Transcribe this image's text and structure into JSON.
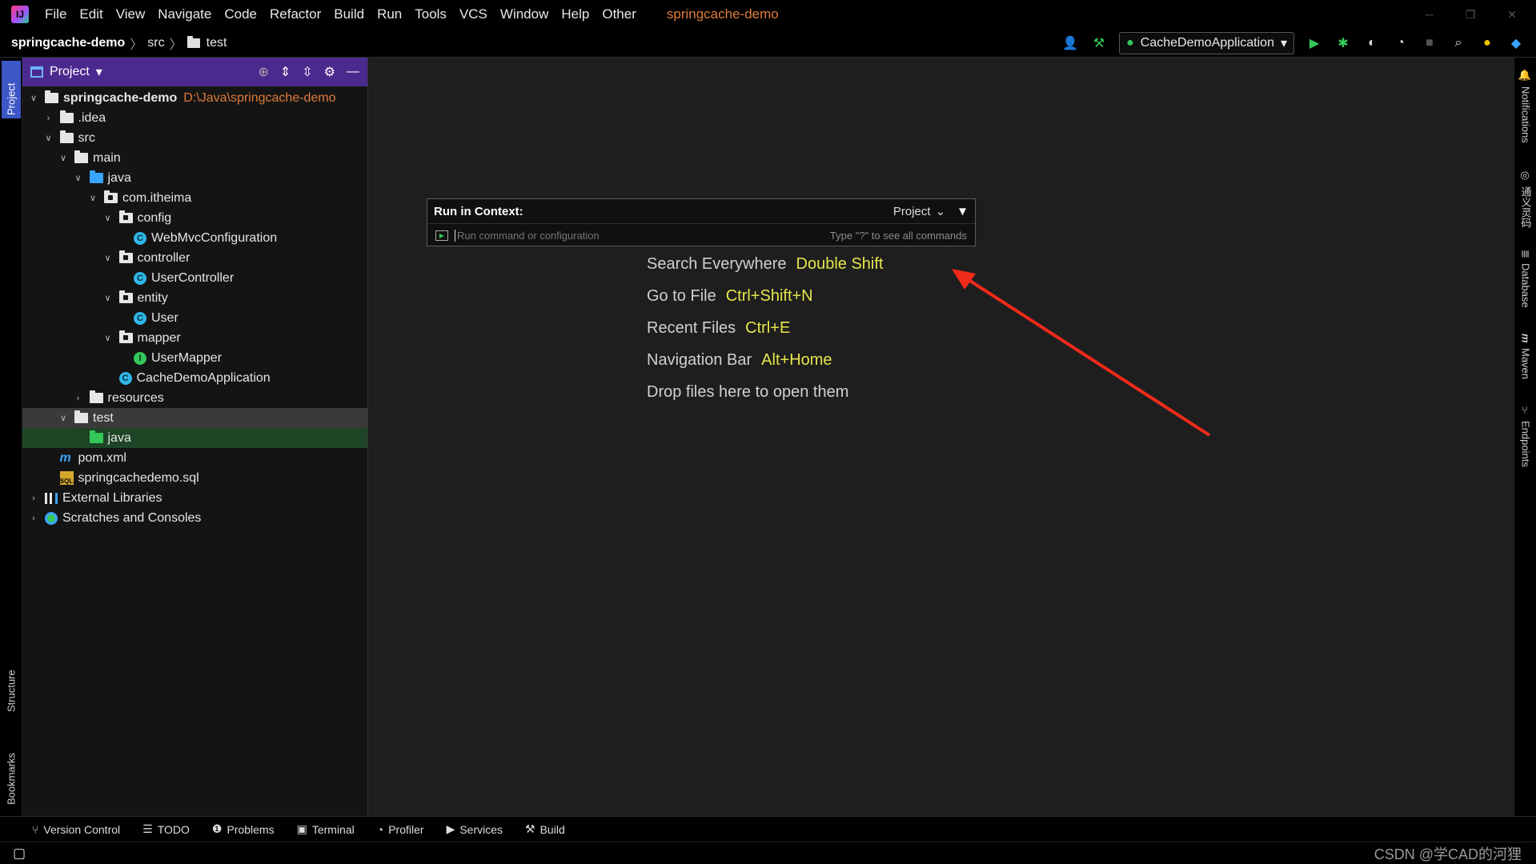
{
  "menubar": {
    "items": [
      "File",
      "Edit",
      "View",
      "Navigate",
      "Code",
      "Refactor",
      "Build",
      "Run",
      "Tools",
      "VCS",
      "Window",
      "Help",
      "Other"
    ],
    "project_title": "springcache-demo"
  },
  "navbar": {
    "breadcrumb": [
      "springcache-demo",
      "src",
      "test"
    ],
    "run_config": "CacheDemoApplication"
  },
  "left_strip": {
    "project_tab": "Project",
    "structure_tab": "Structure",
    "bookmarks_tab": "Bookmarks"
  },
  "right_strip": {
    "notifications": "Notifications",
    "translate": "通义灵码",
    "database": "Database",
    "maven": "Maven",
    "endpoints": "Endpoints"
  },
  "project_panel": {
    "title": "Project",
    "tree": [
      {
        "label": "springcache-demo",
        "path": "D:\\Java\\springcache-demo",
        "level": 0,
        "arrow": "open",
        "icon": "folder",
        "bold": true
      },
      {
        "label": ".idea",
        "level": 1,
        "arrow": "closed",
        "icon": "folder"
      },
      {
        "label": "src",
        "level": 1,
        "arrow": "open",
        "icon": "folder"
      },
      {
        "label": "main",
        "level": 2,
        "arrow": "open",
        "icon": "folder"
      },
      {
        "label": "java",
        "level": 3,
        "arrow": "open",
        "icon": "folder-blue"
      },
      {
        "label": "com.itheima",
        "level": 4,
        "arrow": "open",
        "icon": "package"
      },
      {
        "label": "config",
        "level": 5,
        "arrow": "open",
        "icon": "package"
      },
      {
        "label": "WebMvcConfiguration",
        "level": 6,
        "arrow": "none",
        "icon": "class"
      },
      {
        "label": "controller",
        "level": 5,
        "arrow": "open",
        "icon": "package"
      },
      {
        "label": "UserController",
        "level": 6,
        "arrow": "none",
        "icon": "class"
      },
      {
        "label": "entity",
        "level": 5,
        "arrow": "open",
        "icon": "package"
      },
      {
        "label": "User",
        "level": 6,
        "arrow": "none",
        "icon": "class"
      },
      {
        "label": "mapper",
        "level": 5,
        "arrow": "open",
        "icon": "package"
      },
      {
        "label": "UserMapper",
        "level": 6,
        "arrow": "none",
        "icon": "interface"
      },
      {
        "label": "CacheDemoApplication",
        "level": 5,
        "arrow": "none",
        "icon": "class"
      },
      {
        "label": "resources",
        "level": 3,
        "arrow": "closed",
        "icon": "folder"
      },
      {
        "label": "test",
        "level": 2,
        "arrow": "open",
        "icon": "folder",
        "state": "selected"
      },
      {
        "label": "java",
        "level": 3,
        "arrow": "none",
        "icon": "folder-green",
        "state": "highlight"
      },
      {
        "label": "pom.xml",
        "level": 1,
        "arrow": "none",
        "icon": "maven"
      },
      {
        "label": "springcachedemo.sql",
        "level": 1,
        "arrow": "none",
        "icon": "sql"
      },
      {
        "label": "External Libraries",
        "level": 0,
        "arrow": "closed",
        "icon": "library"
      },
      {
        "label": "Scratches and Consoles",
        "level": 0,
        "arrow": "closed",
        "icon": "scratch"
      }
    ]
  },
  "run_in_context": {
    "label": "Run in Context:",
    "scope": "Project",
    "placeholder": "Run command or configuration",
    "hint": "Type \"?\" to see all commands"
  },
  "editor_hints": [
    {
      "text": "Search Everywhere",
      "key": "Double Shift"
    },
    {
      "text": "Go to File",
      "key": "Ctrl+Shift+N"
    },
    {
      "text": "Recent Files",
      "key": "Ctrl+E"
    },
    {
      "text": "Navigation Bar",
      "key": "Alt+Home"
    },
    {
      "text": "Drop files here to open them",
      "key": ""
    }
  ],
  "bottom_tools": [
    "Version Control",
    "TODO",
    "Problems",
    "Terminal",
    "Profiler",
    "Services",
    "Build"
  ],
  "watermark": "CSDN @学CAD的河狸",
  "colors": {
    "accent": "#4b2a8f",
    "arrow": "#f22a1a",
    "hint_key": "#e6e64c",
    "path": "#e07b39"
  }
}
